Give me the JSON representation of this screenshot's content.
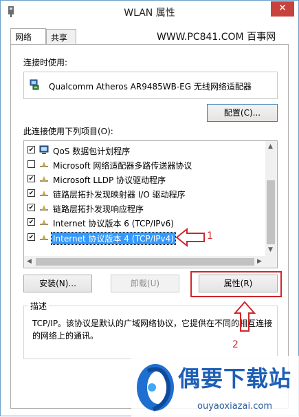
{
  "window": {
    "title": "WLAN 属性",
    "close_glyph": "✕"
  },
  "tabs": [
    {
      "label": "网络",
      "active": true
    },
    {
      "label": "共享",
      "active": false
    }
  ],
  "brand_text": "WWW.PC841.COM 百事网",
  "connect_using_label": "连接时使用:",
  "adapter_name": "Qualcomm Atheros AR9485WB-EG 无线网络适配器",
  "configure_button": "配置(C)...",
  "items_label": "此连接使用下列项目(O):",
  "items": [
    {
      "label": "QoS 数据包计划程序",
      "checked": true,
      "icon": "qos-scheduler-icon"
    },
    {
      "label": "Microsoft 网络适配器多路传送器协议",
      "checked": false,
      "icon": "protocol-icon"
    },
    {
      "label": "Microsoft LLDP 协议驱动程序",
      "checked": true,
      "icon": "protocol-icon"
    },
    {
      "label": "链路层拓扑发现映射器 I/O 驱动程序",
      "checked": true,
      "icon": "protocol-icon"
    },
    {
      "label": "链路层拓扑发现响应程序",
      "checked": true,
      "icon": "protocol-icon"
    },
    {
      "label": "Internet 协议版本 6 (TCP/IPv6)",
      "checked": true,
      "icon": "protocol-icon"
    },
    {
      "label": "Internet 协议版本 4 (TCP/IPv4)",
      "checked": true,
      "icon": "protocol-icon",
      "selected": true
    }
  ],
  "buttons": {
    "install": "安装(N)...",
    "uninstall": "卸载(U)",
    "properties": "属性(R)"
  },
  "description": {
    "legend": "描述",
    "text": "TCP/IP。该协议是默认的广域网络协议，它提供在不同的相互连接的网络上的通讯。"
  },
  "annotations": {
    "marker_1": "1",
    "marker_2": "2",
    "color": "#d0262a"
  },
  "watermark": {
    "title": "偶要下载站",
    "url": "ouyaoxiazai.com"
  },
  "colors": {
    "selection": "#3399ff",
    "close": "#c7413d",
    "accent_border": "#3c7fb1"
  }
}
